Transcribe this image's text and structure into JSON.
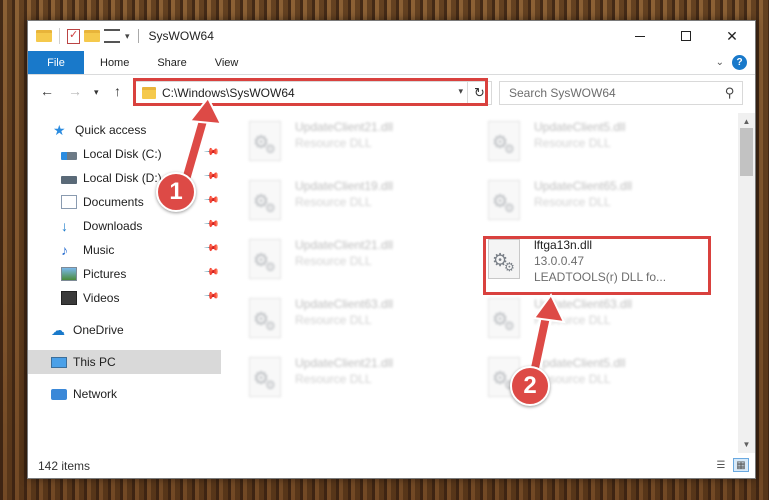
{
  "window": {
    "title": "SysWOW64",
    "minimize_glyph": "—",
    "close_glyph": "✕"
  },
  "ribbon": {
    "tabs": [
      "File",
      "Home",
      "Share",
      "View"
    ],
    "collapse_icon": "chevron-up-icon",
    "help_label": "?"
  },
  "address_bar": {
    "path": "C:\\Windows\\SysWOW64",
    "search_placeholder": "Search SysWOW64"
  },
  "nav_pane": {
    "items": [
      {
        "label": "Quick access",
        "icon": "star-icon",
        "pinned": false
      },
      {
        "label": "Local Disk (C:)",
        "icon": "drive-c-icon",
        "pinned": true
      },
      {
        "label": "Local Disk (D:)",
        "icon": "drive-d-icon",
        "pinned": true
      },
      {
        "label": "Documents",
        "icon": "documents-icon",
        "pinned": true
      },
      {
        "label": "Downloads",
        "icon": "downloads-icon",
        "pinned": true
      },
      {
        "label": "Music",
        "icon": "music-icon",
        "pinned": true
      },
      {
        "label": "Pictures",
        "icon": "pictures-icon",
        "pinned": true
      },
      {
        "label": "Videos",
        "icon": "videos-icon",
        "pinned": true
      },
      {
        "label": "OneDrive",
        "icon": "onedrive-icon",
        "pinned": false
      },
      {
        "label": "This PC",
        "icon": "this-pc-icon",
        "pinned": false,
        "selected": true
      },
      {
        "label": "Network",
        "icon": "network-icon",
        "pinned": false
      }
    ]
  },
  "files": {
    "left_column": [
      {
        "name": "UpdateClient21.dll",
        "type": "Resource DLL"
      },
      {
        "name": "UpdateClient19.dll",
        "type": "Resource DLL"
      },
      {
        "name": "UpdateClient21.dll",
        "type": "Resource DLL"
      },
      {
        "name": "UpdateClient63.dll",
        "type": "Resource DLL"
      },
      {
        "name": "UpdateClient21.dll",
        "type": "Resource DLL"
      }
    ],
    "right_column": [
      {
        "name": "UpdateClient5.dll",
        "type": "Resource DLL"
      },
      {
        "name": "UpdateClient65.dll",
        "type": "Resource DLL"
      },
      {
        "name": "lftga13n.dll",
        "version": "13.0.0.47",
        "description": "LEADTOOLS(r) DLL fo...",
        "highlighted": true
      },
      {
        "name": "UpdateClient63.dll",
        "type": "Resource DLL"
      },
      {
        "name": "UpdateClient5.dll",
        "type": "Resource DLL"
      }
    ]
  },
  "status_bar": {
    "item_count": "142 items"
  },
  "annotations": {
    "step1": "1",
    "step2": "2",
    "color": "#d9413e"
  },
  "colors": {
    "accent": "#1979ca",
    "selection": "#d9d9d9"
  }
}
